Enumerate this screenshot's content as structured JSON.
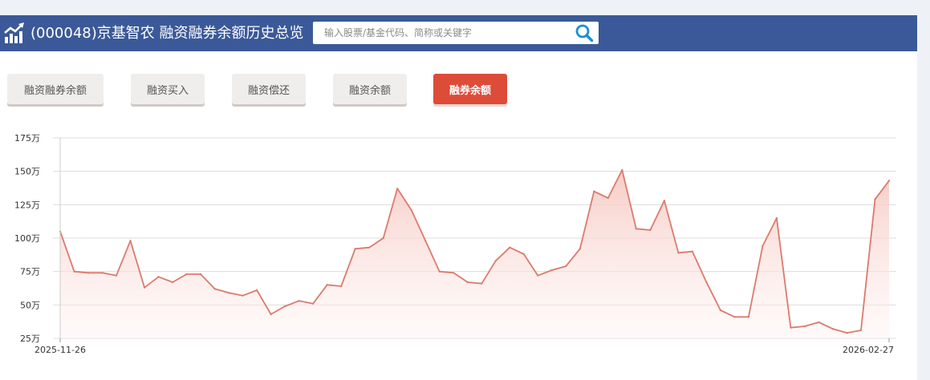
{
  "header": {
    "title": "(000048)京基智农 融资融券余额历史总览",
    "logo_icon": "chart-trend-icon",
    "search": {
      "placeholder": "输入股票/基金代码、简称或关键字",
      "value": ""
    },
    "search_icon": "search-icon"
  },
  "tabs": [
    {
      "label": "融资融券余额",
      "active": false
    },
    {
      "label": "融资买入",
      "active": false
    },
    {
      "label": "融资偿还",
      "active": false
    },
    {
      "label": "融资余额",
      "active": false
    },
    {
      "label": "融券余额",
      "active": true
    }
  ],
  "colors": {
    "header_bg": "#3b5998",
    "active_tab": "#dd4b39",
    "line": "#dc7a6e",
    "area_top": "#f6c9c2"
  },
  "chart_data": {
    "type": "area",
    "title": "",
    "xlabel": "",
    "ylabel": "",
    "ylim": [
      25,
      175
    ],
    "y_ticks": [
      {
        "value": 25,
        "label": "25万"
      },
      {
        "value": 50,
        "label": "50万"
      },
      {
        "value": 75,
        "label": "75万"
      },
      {
        "value": 100,
        "label": "100万"
      },
      {
        "value": 125,
        "label": "125万"
      },
      {
        "value": 150,
        "label": "150万"
      },
      {
        "value": 175,
        "label": "175万"
      }
    ],
    "x_labels": [
      "2025-11-26",
      "2026-02-27"
    ],
    "grid": true,
    "values": [
      105,
      75,
      74,
      74,
      72,
      98,
      63,
      71,
      67,
      73,
      73,
      62,
      59,
      57,
      61,
      43,
      49,
      53,
      51,
      65,
      64,
      92,
      93,
      100,
      137,
      121,
      98,
      75,
      74,
      67,
      66,
      83,
      93,
      88,
      72,
      76,
      79,
      92,
      135,
      130,
      151,
      107,
      106,
      128,
      89,
      90,
      67,
      46,
      41,
      41,
      94,
      115,
      33,
      34,
      37,
      32,
      29,
      31,
      129,
      143
    ]
  }
}
